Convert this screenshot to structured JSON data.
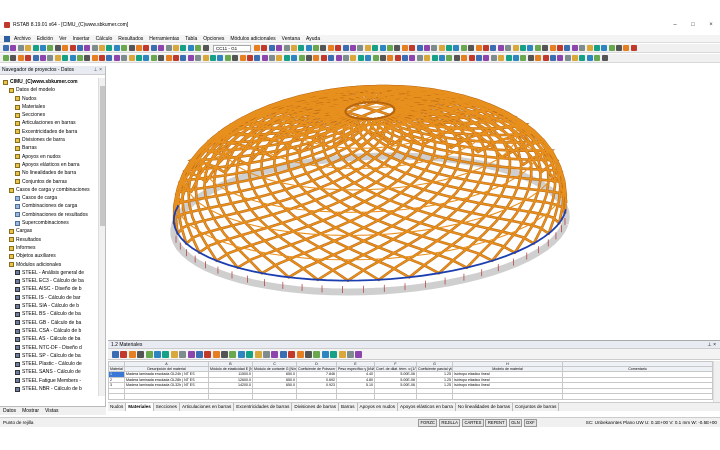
{
  "window": {
    "title": "RSTAB 8.19.01 x64 - [CIMU_(C)www.sbkumer.com]"
  },
  "menu": {
    "items": [
      "Archivo",
      "Edición",
      "Ver",
      "Insertar",
      "Cálculo",
      "Resultados",
      "Herramientas",
      "Tabla",
      "Opciones",
      "Módulos adicionales",
      "Ventana",
      "Ayuda"
    ]
  },
  "toolbar": {
    "combo": "CC11 - G1"
  },
  "navigator": {
    "title": "Navegador de proyectos - Datos",
    "items": [
      {
        "label": "CIMU_(C)www.sbkumer.com",
        "indent": 0,
        "icon": "folder"
      },
      {
        "label": "Datos del modelo",
        "indent": 1,
        "icon": "folder"
      },
      {
        "label": "Nudos",
        "indent": 2,
        "icon": "folder"
      },
      {
        "label": "Materiales",
        "indent": 2,
        "icon": "folder"
      },
      {
        "label": "Secciones",
        "indent": 2,
        "icon": "folder"
      },
      {
        "label": "Articulaciones en barras",
        "indent": 2,
        "icon": "folder"
      },
      {
        "label": "Excentricidades de barra",
        "indent": 2,
        "icon": "folder"
      },
      {
        "label": "Divisiones de barra",
        "indent": 2,
        "icon": "folder"
      },
      {
        "label": "Barras",
        "indent": 2,
        "icon": "folder"
      },
      {
        "label": "Apoyos en nudos",
        "indent": 2,
        "icon": "folder"
      },
      {
        "label": "Apoyos elásticos en barra",
        "indent": 2,
        "icon": "folder"
      },
      {
        "label": "No linealidades de barra",
        "indent": 2,
        "icon": "folder"
      },
      {
        "label": "Conjuntos de barras",
        "indent": 2,
        "icon": "folder"
      },
      {
        "label": "Casos de carga y combinaciones",
        "indent": 1,
        "icon": "folder"
      },
      {
        "label": "Casos de carga",
        "indent": 2,
        "icon": "doc"
      },
      {
        "label": "Combinaciones de carga",
        "indent": 2,
        "icon": "doc"
      },
      {
        "label": "Combinaciones de resultados",
        "indent": 2,
        "icon": "doc"
      },
      {
        "label": "Supercombinaciones",
        "indent": 2,
        "icon": "doc"
      },
      {
        "label": "Cargas",
        "indent": 1,
        "icon": "folder"
      },
      {
        "label": "Resultados",
        "indent": 1,
        "icon": "folder"
      },
      {
        "label": "Informes",
        "indent": 1,
        "icon": "folder"
      },
      {
        "label": "Objetos auxiliares",
        "indent": 1,
        "icon": "folder"
      },
      {
        "label": "Módulos adicionales",
        "indent": 1,
        "icon": "folder"
      },
      {
        "label": "STEEL - Análisis general de",
        "indent": 2,
        "icon": "mod"
      },
      {
        "label": "STEEL EC3 - Cálculo de ba",
        "indent": 2,
        "icon": "mod"
      },
      {
        "label": "STEEL AISC - Diseño de b",
        "indent": 2,
        "icon": "mod"
      },
      {
        "label": "STEEL IS - Cálculo de bar",
        "indent": 2,
        "icon": "mod"
      },
      {
        "label": "STEEL SIA - Cálculo de b",
        "indent": 2,
        "icon": "mod"
      },
      {
        "label": "STEEL BS - Cálculo de ba",
        "indent": 2,
        "icon": "mod"
      },
      {
        "label": "STEEL GB - Cálculo de ba",
        "indent": 2,
        "icon": "mod"
      },
      {
        "label": "STEEL CSA - Cálculo de b",
        "indent": 2,
        "icon": "mod"
      },
      {
        "label": "STEEL AS - Cálculo de ba",
        "indent": 2,
        "icon": "mod"
      },
      {
        "label": "STEEL NTC-DF - Diseño d",
        "indent": 2,
        "icon": "mod"
      },
      {
        "label": "STEEL SP - Cálculo de ba",
        "indent": 2,
        "icon": "mod"
      },
      {
        "label": "STEEL Plastic - Cálculo de",
        "indent": 2,
        "icon": "mod"
      },
      {
        "label": "STEEL SANS - Cálculo de",
        "indent": 2,
        "icon": "mod"
      },
      {
        "label": "STEEL Fatigue Members - ",
        "indent": 2,
        "icon": "mod"
      },
      {
        "label": "STEEL NBR - Cálculo de b",
        "indent": 2,
        "icon": "mod"
      }
    ],
    "tabs": [
      "Datos",
      "Mostrar",
      "Vistas"
    ]
  },
  "table": {
    "title": "1.2 Materiales",
    "headers": [
      "Material núm.",
      "Descripción del material",
      "Módulo de elasticidad E [N/mm²]",
      "Módulo de cortante G [N/mm²]",
      "Coeficiente de Poisson ν [-]",
      "Peso específico γ [kN/m³]",
      "Coef. de dilat. térm. α [1/°C]",
      "Coeficiente parcial γM [-]",
      "Modelo de material",
      "Comentario"
    ],
    "col_letters": [
      "",
      "A",
      "B",
      "C",
      "D",
      "E",
      "F",
      "G",
      "H",
      ""
    ],
    "rows": [
      [
        "1",
        "Madera laminada encolada GL24h | NT ES",
        "11500.0",
        "650.0",
        "7.846",
        "4.40",
        "5.00E-06",
        "1.25",
        "Isótropo elástico lineal",
        ""
      ],
      [
        "2",
        "Madera laminada encolada GL28h | NT ES",
        "12600.0",
        "650.0",
        "0.692",
        "4.80",
        "5.00E-06",
        "1.25",
        "Isótropo elástico lineal",
        ""
      ],
      [
        "3",
        "Madera laminada encolada GL32h | NT ES",
        "14200.0",
        "650.0",
        "0.923",
        "5.10",
        "5.00E-06",
        "1.25",
        "Isótropo elástico lineal",
        ""
      ]
    ],
    "sheet_tabs": [
      "Nudos",
      "Materiales",
      "Secciones",
      "Articulaciones en barras",
      "Excentricidades de barras",
      "Divisiones de barras",
      "Barras",
      "Apoyos en nudos",
      "Apoyos elásticos en barra",
      "No linealidades de barras",
      "Conjuntos de barras"
    ]
  },
  "statusbar": {
    "message": "Punto de rejilla",
    "buttons": [
      "FORZC",
      "REJILLA",
      "CARTES",
      "REFENT",
      "GLN",
      "DXF"
    ],
    "info": "SC: Unbekanntes Plano UW    U: 0.1E+00 V: 0.1 mm    W: -0.5E+00"
  },
  "colors": {
    "timber": "#e8901e",
    "timber_dark": "#b8650e",
    "tension_ring": "#1c3fb0",
    "foundation": "#cfcfcf",
    "accent": "#3a78d8"
  }
}
